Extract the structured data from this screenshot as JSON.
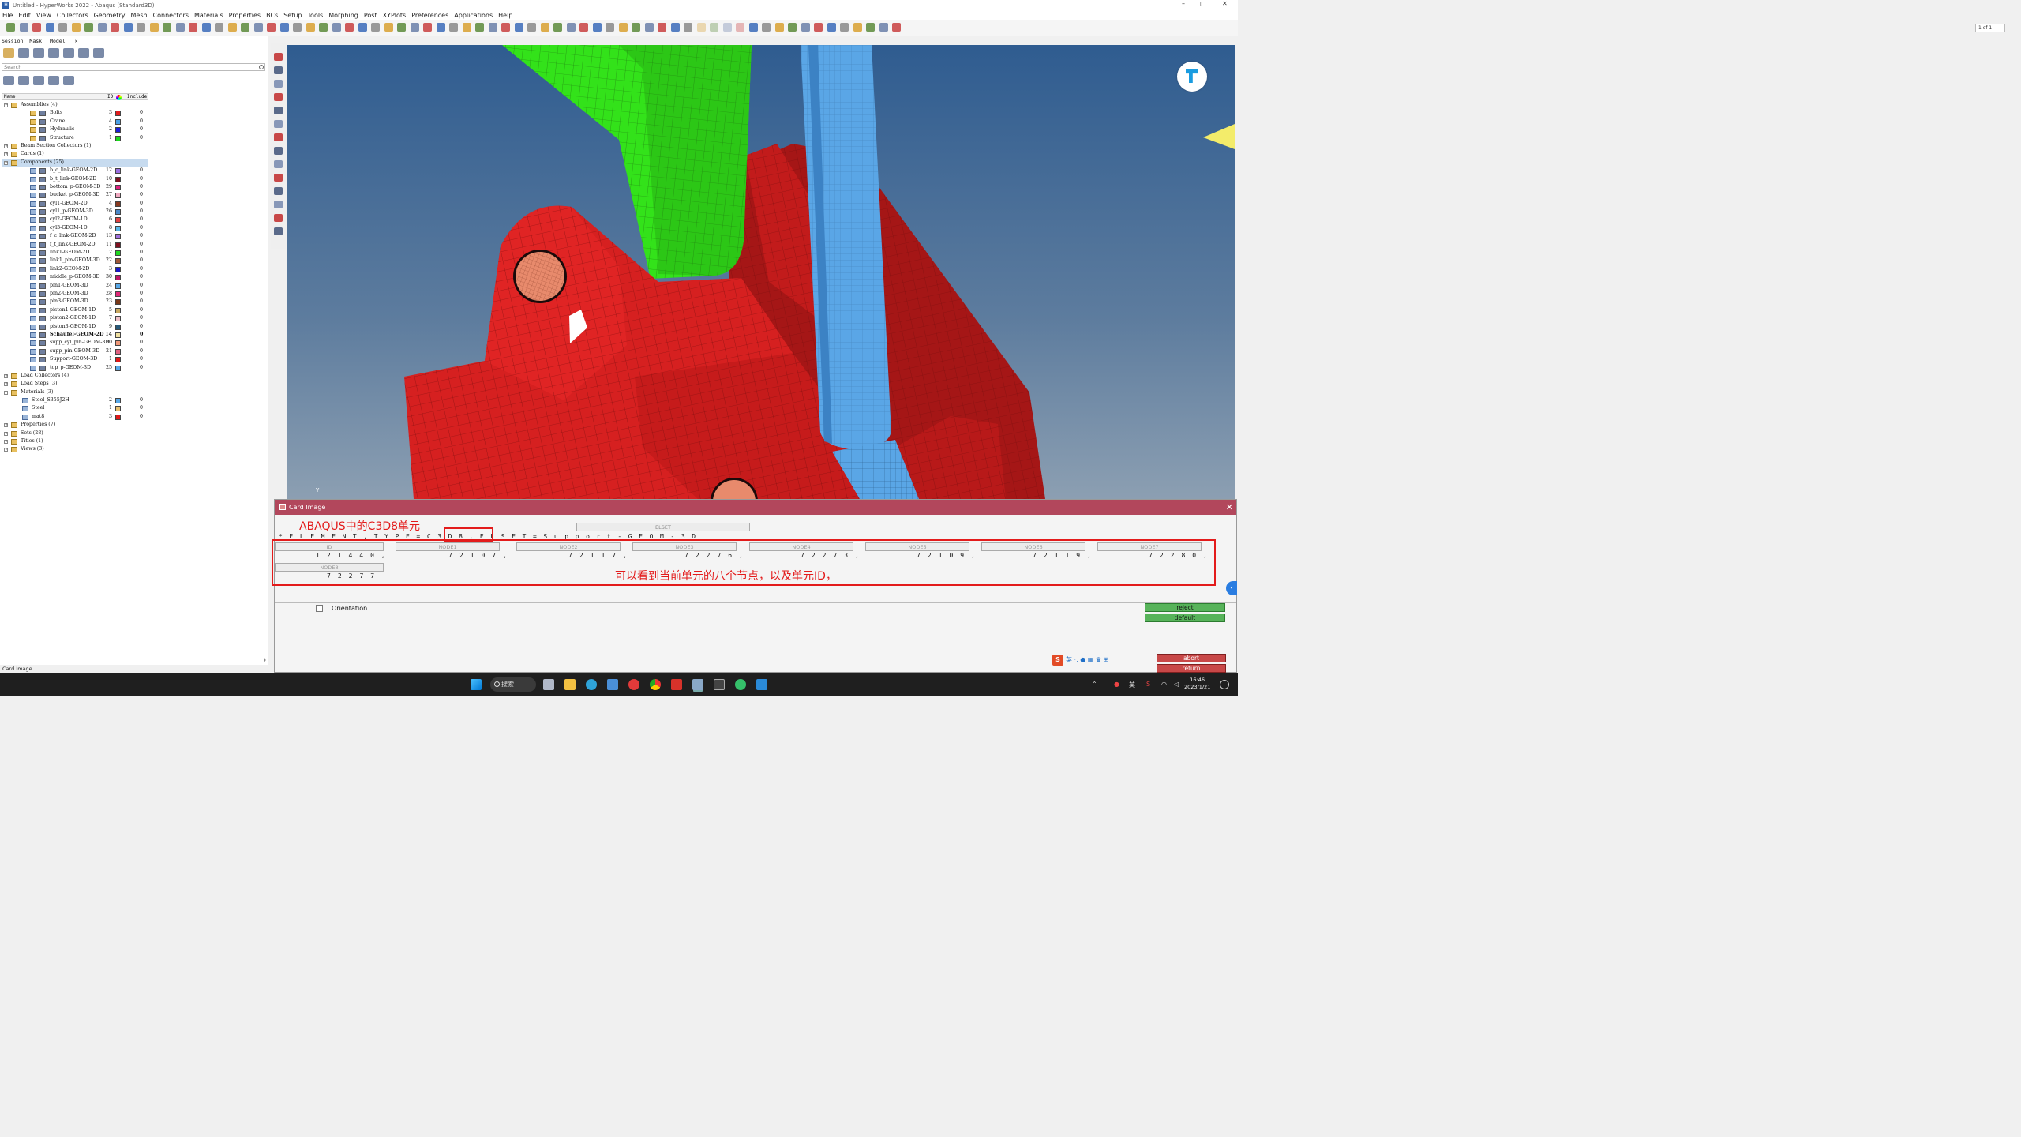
{
  "window": {
    "title": "Untitled - HyperWorks 2022 - Abaqus (Standard3D)",
    "minimize": "–",
    "maximize": "▢",
    "close": "✕"
  },
  "menu": [
    "File",
    "Edit",
    "View",
    "Collectors",
    "Geometry",
    "Mesh",
    "Connectors",
    "Materials",
    "Properties",
    "BCs",
    "Setup",
    "Tools",
    "Morphing",
    "Post",
    "XYPlots",
    "Preferences",
    "Applications",
    "Help"
  ],
  "toolbar": {
    "page_indicator": "1 of 1"
  },
  "left_panel": {
    "tabs": [
      {
        "label": "Session"
      },
      {
        "label": "Mask"
      },
      {
        "label": "Model"
      }
    ],
    "tab_close": "✕",
    "search_placeholder": "Search",
    "columns": {
      "name": "Name",
      "id": "ID",
      "include": "Include"
    },
    "tree": [
      {
        "label": "Assemblies (4)",
        "level": 0,
        "expand": "−",
        "kind": "folder"
      },
      {
        "label": "Bolts",
        "level": 2,
        "id": "3",
        "color": "#e01b1b",
        "include": "0",
        "kind": "assembly"
      },
      {
        "label": "Crane",
        "level": 2,
        "id": "4",
        "color": "#4aa0e6",
        "include": "0",
        "kind": "assembly"
      },
      {
        "label": "Hydraulic",
        "level": 2,
        "id": "2",
        "color": "#1c1cd8",
        "include": "0",
        "kind": "assembly"
      },
      {
        "label": "Structure",
        "level": 2,
        "id": "1",
        "color": "#1bd81b",
        "include": "0",
        "kind": "assembly"
      },
      {
        "label": "Beam Section Collectors (1)",
        "level": 0,
        "expand": "+",
        "kind": "folder"
      },
      {
        "label": "Cards (1)",
        "level": 0,
        "expand": "+",
        "kind": "folder"
      },
      {
        "label": "Components (25)",
        "level": 0,
        "expand": "−",
        "kind": "folder",
        "selected": true
      },
      {
        "label": "b_c_link-GEOM-2D",
        "level": 2,
        "id": "12",
        "color": "#9a6ee0",
        "include": "0",
        "kind": "comp"
      },
      {
        "label": "b_t_link-GEOM-2D",
        "level": 2,
        "id": "10",
        "color": "#7a1220",
        "include": "0",
        "kind": "comp"
      },
      {
        "label": "bottom_p-GEOM-3D",
        "level": 2,
        "id": "29",
        "color": "#e02080",
        "include": "0",
        "kind": "comp"
      },
      {
        "label": "bucket_p-GEOM-3D",
        "level": 2,
        "id": "27",
        "color": "#f0a8c0",
        "include": "0",
        "kind": "comp"
      },
      {
        "label": "cyl1-GEOM-2D",
        "level": 2,
        "id": "4",
        "color": "#8a3a20",
        "include": "0",
        "kind": "comp"
      },
      {
        "label": "cyl1_p-GEOM-3D",
        "level": 2,
        "id": "26",
        "color": "#4a88c8",
        "include": "0",
        "kind": "comp"
      },
      {
        "label": "cyl2-GEOM-1D",
        "level": 2,
        "id": "6",
        "color": "#e04040",
        "include": "0",
        "kind": "comp"
      },
      {
        "label": "cyl3-GEOM-1D",
        "level": 2,
        "id": "8",
        "color": "#58b8e8",
        "include": "0",
        "kind": "comp"
      },
      {
        "label": "f_c_link-GEOM-2D",
        "level": 2,
        "id": "13",
        "color": "#a070e0",
        "include": "0",
        "kind": "comp"
      },
      {
        "label": "f_t_link-GEOM-2D",
        "level": 2,
        "id": "11",
        "color": "#801020",
        "include": "0",
        "kind": "comp"
      },
      {
        "label": "link1-GEOM-2D",
        "level": 2,
        "id": "2",
        "color": "#20d820",
        "include": "0",
        "kind": "comp"
      },
      {
        "label": "link1_pin-GEOM-3D",
        "level": 2,
        "id": "22",
        "color": "#a05838",
        "include": "0",
        "kind": "comp"
      },
      {
        "label": "link2-GEOM-2D",
        "level": 2,
        "id": "3",
        "color": "#1818c8",
        "include": "0",
        "kind": "comp"
      },
      {
        "label": "middle_p-GEOM-3D",
        "level": 2,
        "id": "30",
        "color": "#c01868",
        "include": "0",
        "kind": "comp"
      },
      {
        "label": "pin1-GEOM-3D",
        "level": 2,
        "id": "24",
        "color": "#58a8e8",
        "include": "0",
        "kind": "comp"
      },
      {
        "label": "pin2-GEOM-3D",
        "level": 2,
        "id": "28",
        "color": "#e02878",
        "include": "0",
        "kind": "comp"
      },
      {
        "label": "pin3-GEOM-3D",
        "level": 2,
        "id": "23",
        "color": "#7a3818",
        "include": "0",
        "kind": "comp"
      },
      {
        "label": "piston1-GEOM-1D",
        "level": 2,
        "id": "5",
        "color": "#c8a860",
        "include": "0",
        "kind": "comp"
      },
      {
        "label": "piston2-GEOM-1D",
        "level": 2,
        "id": "7",
        "color": "#f0c0c8",
        "include": "0",
        "kind": "comp"
      },
      {
        "label": "piston3-GEOM-1D",
        "level": 2,
        "id": "9",
        "color": "#285878",
        "include": "0",
        "kind": "comp"
      },
      {
        "label": "Schaufel-GEOM-2D",
        "level": 2,
        "id": "14",
        "color": "#f0e0a0",
        "include": "0",
        "kind": "comp",
        "bold": true
      },
      {
        "label": "supp_cyl_pin-GEOM-3D",
        "level": 2,
        "id": "20",
        "color": "#f09878",
        "include": "0",
        "kind": "comp"
      },
      {
        "label": "supp_pin-GEOM-3D",
        "level": 2,
        "id": "21",
        "color": "#e06080",
        "include": "0",
        "kind": "comp"
      },
      {
        "label": "Support-GEOM-3D",
        "level": 2,
        "id": "1",
        "color": "#e01818",
        "include": "0",
        "kind": "comp"
      },
      {
        "label": "top_p-GEOM-3D",
        "level": 2,
        "id": "25",
        "color": "#58a8e8",
        "include": "0",
        "kind": "comp"
      },
      {
        "label": "Load Collectors (4)",
        "level": 0,
        "expand": "+",
        "kind": "folder"
      },
      {
        "label": "Load Steps (3)",
        "level": 0,
        "expand": "+",
        "kind": "folder"
      },
      {
        "label": "Materials (3)",
        "level": 0,
        "expand": "−",
        "kind": "folder"
      },
      {
        "label": "Steel_S355J2H",
        "level": 1,
        "id": "2",
        "color": "#58a8e8",
        "include": "0",
        "kind": "mat"
      },
      {
        "label": "Steel",
        "level": 1,
        "id": "1",
        "color": "#e8c070",
        "include": "0",
        "kind": "mat"
      },
      {
        "label": "mat8",
        "level": 1,
        "id": "3",
        "color": "#e01818",
        "include": "0",
        "kind": "mat"
      },
      {
        "label": "Properties (7)",
        "level": 0,
        "expand": "+",
        "kind": "folder"
      },
      {
        "label": "Sets (28)",
        "level": 0,
        "expand": "+",
        "kind": "folder"
      },
      {
        "label": "Titles (1)",
        "level": 0,
        "expand": "+",
        "kind": "folder"
      },
      {
        "label": "Views (3)",
        "level": 0,
        "expand": "+",
        "kind": "folder"
      }
    ],
    "status": "Card Image"
  },
  "viewport": {
    "axis_label": "Y"
  },
  "card_image": {
    "title": "Card Image",
    "close": "✕",
    "annotation_top": "ABAQUS中的C3D8单元",
    "annotation_main": "可以看到当前单元的八个节点，以及单元ID，",
    "elset_header": "ELSET",
    "element_line": "*ELEMENT,TYPE=C3D8,ELSET=Support-GEOM-3D",
    "fields": [
      {
        "header": "ID",
        "value": "121440,"
      },
      {
        "header": "NODE1",
        "value": "72107,"
      },
      {
        "header": "NODE2",
        "value": "72117,"
      },
      {
        "header": "NODE3",
        "value": "72276,"
      },
      {
        "header": "NODE4",
        "value": "72273,"
      },
      {
        "header": "NODE5",
        "value": "72109,"
      },
      {
        "header": "NODE6",
        "value": "72119,"
      },
      {
        "header": "NODE7",
        "value": "72280,"
      },
      {
        "header": "NODE8",
        "value": "72277"
      }
    ],
    "orientation_label": "Orientation",
    "reject_label": "reject",
    "default_label": "default",
    "abort_label": "abort",
    "return_label": "return"
  },
  "ime": {
    "logo": "S",
    "lang": "英"
  },
  "taskbar": {
    "search_label": "搜索",
    "tray_lang": "英",
    "time": "16:46",
    "date": "2023/1/21"
  },
  "colors": {
    "viewport_top": "#2f5c90",
    "mesh_red": "#d62020",
    "mesh_green": "#33e21a",
    "cylinder_blue": "#5aa6e6",
    "card_header": "#b2475c",
    "annotation_red": "#e31b1b"
  }
}
